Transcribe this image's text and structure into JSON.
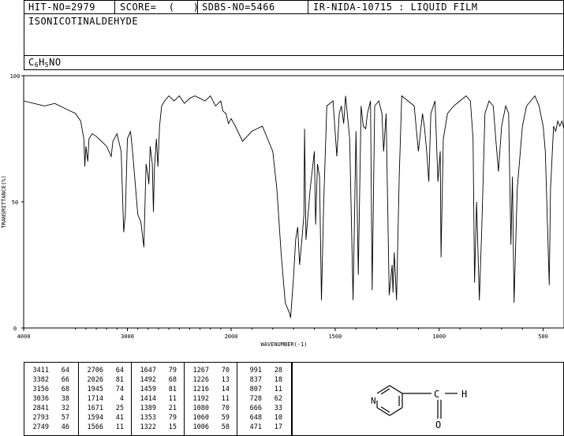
{
  "header": {
    "hit_no": "HIT-NO=2979",
    "score": "SCORE=  (   )",
    "sdbs_no": "SDBS-NO=5466",
    "method": "IR-NIDA-10715 : LIQUID FILM",
    "compound_name": "ISONICOTINALDEHYDE",
    "formula_c": "C",
    "formula_c_sub": "6",
    "formula_h": "H",
    "formula_h_sub": "5",
    "formula_rest": "NO"
  },
  "chart_data": {
    "type": "line",
    "xlabel": "WAVENUMBER(-1)",
    "ylabel": "TRANSMITTANCE(%)",
    "xlim": [
      4000,
      400
    ],
    "ylim": [
      0,
      100
    ],
    "x_ticks": [
      4000,
      3000,
      2000,
      1500,
      1000,
      500
    ],
    "y_ticks": [
      0,
      50,
      100
    ],
    "grid": false,
    "series": [
      {
        "x": [
          4000,
          3900,
          3800,
          3700,
          3600,
          3500,
          3450,
          3420,
          3411,
          3400,
          3382,
          3370,
          3340,
          3300,
          3250,
          3200,
          3156,
          3140,
          3100,
          3060,
          3036,
          3020,
          3000,
          2970,
          2950,
          2920,
          2900,
          2870,
          2841,
          2830,
          2820,
          2800,
          2793,
          2780,
          2760,
          2749,
          2740,
          2720,
          2706,
          2690,
          2670,
          2640,
          2600,
          2550,
          2500,
          2450,
          2400,
          2350,
          2300,
          2250,
          2200,
          2150,
          2100,
          2080,
          2050,
          2026,
          2000,
          1980,
          1945,
          1900,
          1850,
          1800,
          1780,
          1760,
          1740,
          1720,
          1714,
          1700,
          1690,
          1680,
          1671,
          1660,
          1650,
          1647,
          1640,
          1620,
          1600,
          1594,
          1585,
          1575,
          1566,
          1555,
          1540,
          1510,
          1492,
          1480,
          1470,
          1459,
          1450,
          1430,
          1414,
          1400,
          1389,
          1375,
          1365,
          1353,
          1345,
          1330,
          1322,
          1310,
          1290,
          1275,
          1267,
          1255,
          1240,
          1226,
          1222,
          1216,
          1205,
          1192,
          1180,
          1150,
          1120,
          1100,
          1080,
          1070,
          1060,
          1050,
          1040,
          1020,
          1006,
          995,
          991,
          980,
          960,
          930,
          900,
          870,
          850,
          837,
          830,
          820,
          807,
          795,
          780,
          760,
          740,
          728,
          715,
          700,
          680,
          666,
          655,
          648,
          640,
          625,
          600,
          580,
          560,
          540,
          520,
          500,
          490,
          471,
          465,
          450,
          440,
          430,
          420,
          410,
          400
        ],
        "y": [
          90,
          89,
          88,
          89,
          87,
          85,
          82,
          75,
          64,
          72,
          66,
          75,
          77,
          76,
          74,
          72,
          68,
          74,
          77,
          70,
          38,
          45,
          75,
          78,
          70,
          55,
          45,
          42,
          32,
          50,
          65,
          60,
          57,
          72,
          65,
          46,
          63,
          75,
          64,
          80,
          88,
          90,
          92,
          90,
          92,
          89,
          91,
          92,
          91,
          90,
          92,
          88,
          90,
          86,
          85,
          81,
          83,
          80,
          74,
          78,
          80,
          70,
          55,
          30,
          10,
          6,
          4,
          20,
          35,
          40,
          25,
          35,
          45,
          79,
          35,
          55,
          70,
          41,
          65,
          60,
          11,
          50,
          88,
          90,
          68,
          85,
          88,
          81,
          92,
          75,
          11,
          78,
          21,
          88,
          80,
          79,
          85,
          90,
          15,
          88,
          90,
          85,
          70,
          85,
          13,
          25,
          14,
          30,
          11,
          60,
          92,
          90,
          88,
          70,
          85,
          79,
          70,
          58,
          85,
          90,
          58,
          70,
          28,
          75,
          85,
          88,
          90,
          92,
          90,
          75,
          18,
          50,
          11,
          40,
          85,
          90,
          88,
          75,
          62,
          80,
          88,
          85,
          33,
          60,
          10,
          55,
          80,
          88,
          90,
          92,
          88,
          80,
          70,
          17,
          55,
          80,
          78,
          82,
          80,
          82,
          79
        ]
      }
    ]
  },
  "peak_table": {
    "columns": [
      [
        [
          "3411",
          "64"
        ],
        [
          "3382",
          "66"
        ],
        [
          "3156",
          "68"
        ],
        [
          "3036",
          "38"
        ],
        [
          "2841",
          "32"
        ],
        [
          "2793",
          "57"
        ],
        [
          "2749",
          "46"
        ]
      ],
      [
        [
          "2706",
          "64"
        ],
        [
          "2026",
          "81"
        ],
        [
          "1945",
          "74"
        ],
        [
          "1714",
          "4"
        ],
        [
          "1671",
          "25"
        ],
        [
          "1594",
          "41"
        ],
        [
          "1566",
          "11"
        ]
      ],
      [
        [
          "1647",
          "79"
        ],
        [
          "1492",
          "68"
        ],
        [
          "1459",
          "81"
        ],
        [
          "1414",
          "11"
        ],
        [
          "1389",
          "21"
        ],
        [
          "1353",
          "79"
        ],
        [
          "1322",
          "15"
        ]
      ],
      [
        [
          "1267",
          "70"
        ],
        [
          "1226",
          "13"
        ],
        [
          "1216",
          "14"
        ],
        [
          "1192",
          "11"
        ],
        [
          "1080",
          "70"
        ],
        [
          "1060",
          "59"
        ],
        [
          "1006",
          "58"
        ]
      ],
      [
        [
          "991",
          "28"
        ],
        [
          "837",
          "18"
        ],
        [
          "807",
          "11"
        ],
        [
          "728",
          "62"
        ],
        [
          "666",
          "33"
        ],
        [
          "648",
          "10"
        ],
        [
          "471",
          "17"
        ]
      ]
    ]
  },
  "structure": {
    "atom_n": "N",
    "atom_c": "C",
    "atom_h": "H",
    "atom_o": "O"
  }
}
